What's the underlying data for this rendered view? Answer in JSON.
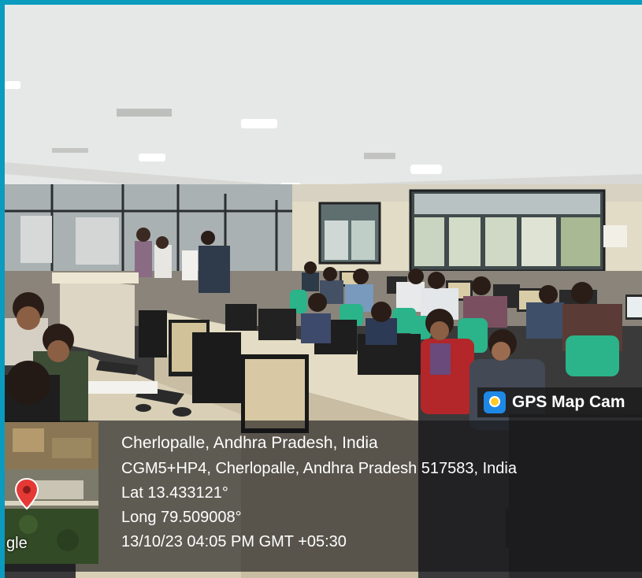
{
  "overlay": {
    "brand": "GPS Map Cam",
    "map_label": "gle",
    "address_title": "Cherlopalle, Andhra Pradesh, India",
    "address_line": "CGM5+HP4, Cherlopalle, Andhra Pradesh 517583, India",
    "lat": "Lat 13.433121°",
    "long": "Long 79.509008°",
    "datetime": "13/10/23 04:05 PM GMT +05:30"
  },
  "icons": {
    "brand_logo": "gps-camera-logo-icon",
    "map_pin": "map-pin-icon"
  },
  "colors": {
    "frame": "#0a9bbf",
    "map_pin": "#e53935",
    "chairs": "#2bb38a",
    "kurta": "#b3262a"
  }
}
